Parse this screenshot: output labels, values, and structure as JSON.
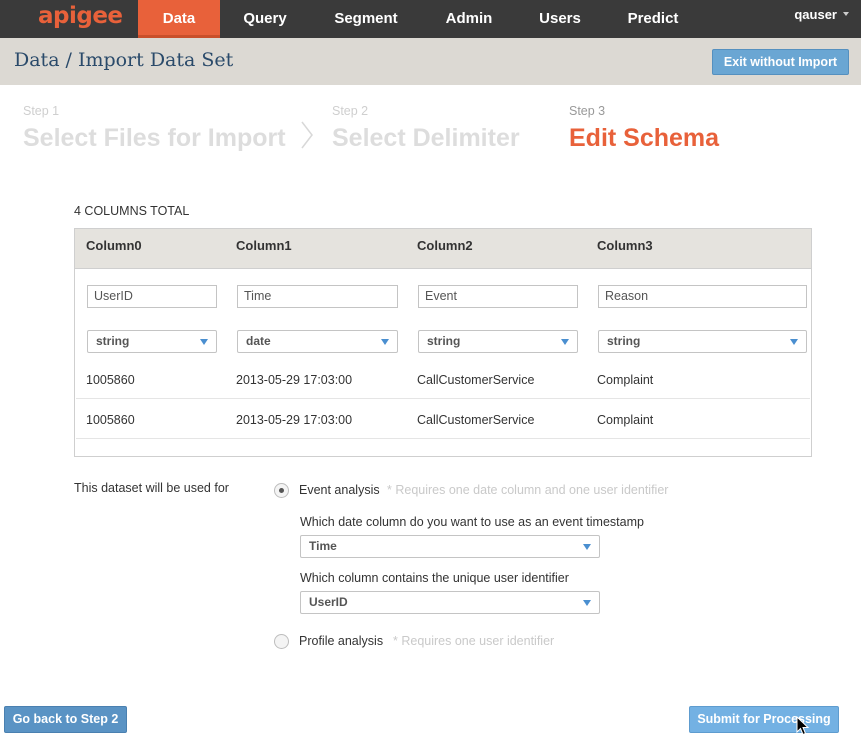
{
  "nav": {
    "logo": "apigee",
    "items": [
      "Data",
      "Query",
      "Segment",
      "Admin",
      "Users",
      "Predict"
    ],
    "active_index": 0,
    "user": "qauser"
  },
  "breadcrumb": {
    "root": "Data",
    "separator": "/",
    "current": "Import Data Set"
  },
  "exit_button": "Exit without Import",
  "steps": [
    {
      "num": "Step 1",
      "title": "Select Files for Import"
    },
    {
      "num": "Step 2",
      "title": "Select Delimiter"
    },
    {
      "num": "Step 3",
      "title": "Edit Schema"
    }
  ],
  "active_step": 3,
  "columns_total": "4 COLUMNS TOTAL",
  "table": {
    "headers": [
      "Column0",
      "Column1",
      "Column2",
      "Column3"
    ],
    "names": [
      "UserID",
      "Time",
      "Event",
      "Reason"
    ],
    "types": [
      "string",
      "date",
      "string",
      "string"
    ],
    "rows": [
      [
        "1005860",
        "2013-05-29 17:03:00",
        "CallCustomerService",
        "Complaint"
      ],
      [
        "1005860",
        "2013-05-29 17:03:00",
        "CallCustomerService",
        "Complaint"
      ]
    ]
  },
  "usage": {
    "label": "This dataset will be used for",
    "event_option": "Event analysis",
    "event_hint": "* Requires one date column and one user identifier",
    "event_selected": true,
    "timestamp_question": "Which date column do you want to use as an event timestamp",
    "timestamp_value": "Time",
    "user_question": "Which column contains the unique user identifier",
    "user_value": "UserID",
    "profile_option": "Profile analysis",
    "profile_hint": "* Requires one user identifier"
  },
  "buttons": {
    "back": "Go back to Step 2",
    "submit": "Submit for Processing"
  },
  "colors": {
    "accent": "#e8613a",
    "nav_bg": "#3a3a3a",
    "button_blue": "#6aa6d3"
  }
}
